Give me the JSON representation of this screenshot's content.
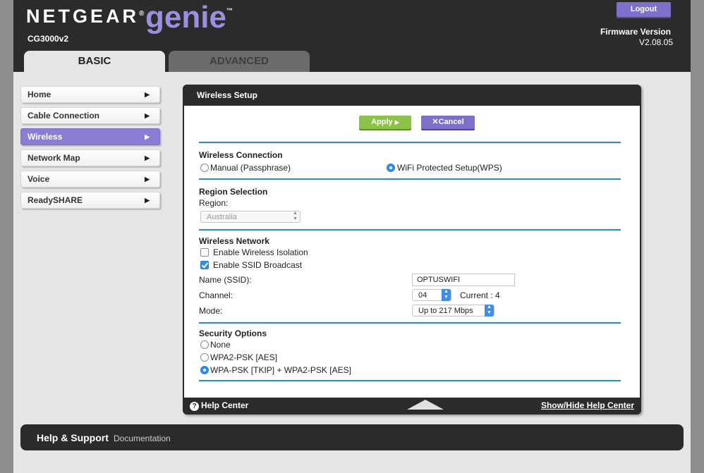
{
  "header": {
    "brand": "NETGEAR",
    "brand_tm": "®",
    "product": "genie",
    "product_tm": "™",
    "model": "CG3000v2",
    "logout_label": "Logout",
    "firmware_label": "Firmware Version",
    "firmware_value": "V2.08.05"
  },
  "tabs": [
    {
      "label": "BASIC",
      "active": true
    },
    {
      "label": "ADVANCED",
      "active": false
    }
  ],
  "sidebar": {
    "items": [
      {
        "label": "Home"
      },
      {
        "label": "Cable Connection"
      },
      {
        "label": "Wireless",
        "active": true
      },
      {
        "label": "Network Map"
      },
      {
        "label": "Voice"
      },
      {
        "label": "ReadySHARE"
      }
    ],
    "arrow_glyph": "▶"
  },
  "panel": {
    "title": "Wireless Setup",
    "apply_label": "Apply",
    "apply_glyph": "▶",
    "cancel_label": "Cancel",
    "cancel_glyph": "✕",
    "wireless_connection": {
      "title": "Wireless Connection",
      "option_manual": "Manual (Passphrase)",
      "option_wps": "WiFi Protected Setup(WPS)",
      "selected": "wps"
    },
    "region": {
      "title": "Region Selection",
      "label": "Region:",
      "value": "Australia"
    },
    "network": {
      "title": "Wireless Network",
      "isolation_label": "Enable Wireless Isolation",
      "isolation_checked": false,
      "ssid_broadcast_label": "Enable SSID Broadcast",
      "ssid_broadcast_checked": true,
      "ssid_label": "Name (SSID):",
      "ssid_value": "OPTUSWIFI",
      "channel_label": "Channel:",
      "channel_value": "04",
      "current_channel": "Current : 4",
      "mode_label": "Mode:",
      "mode_value": "Up to 217 Mbps"
    },
    "security": {
      "title": "Security Options",
      "options": [
        "None",
        "WPA2-PSK [AES]",
        "WPA-PSK [TKIP] + WPA2-PSK [AES]"
      ],
      "selected_index": 2
    },
    "footer": {
      "help_center": "Help Center",
      "help_glyph": "?",
      "show_hide": "Show/Hide Help Center"
    }
  },
  "bottom": {
    "help_support": "Help & Support",
    "documentation": "Documentation"
  }
}
